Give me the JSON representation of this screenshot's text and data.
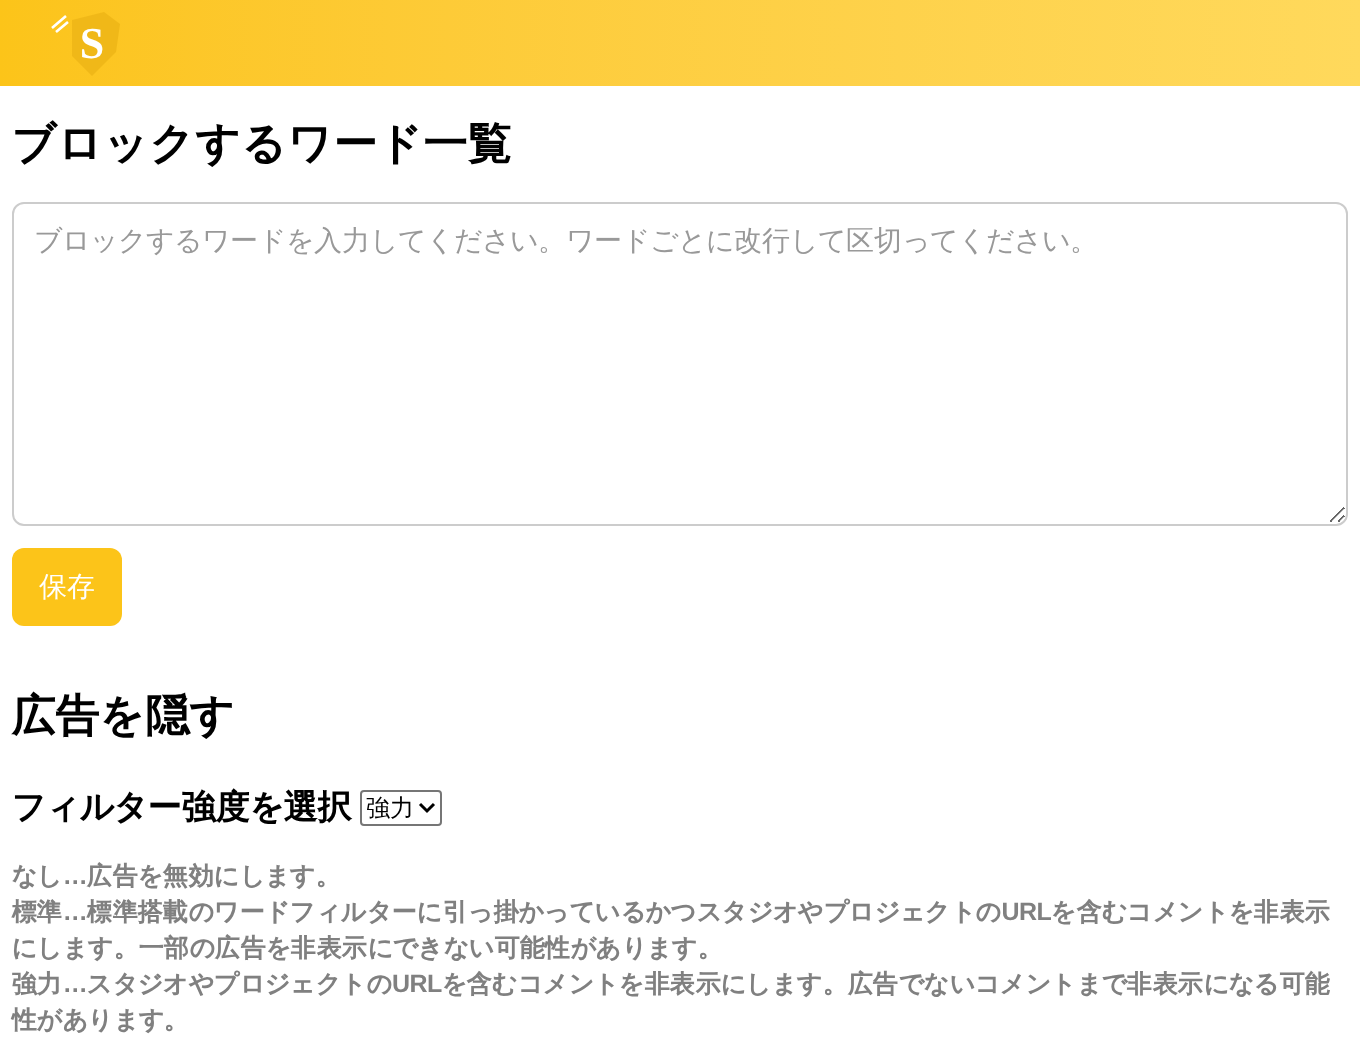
{
  "header": {
    "logo_letter": "S"
  },
  "block_words": {
    "title": "ブロックするワード一覧",
    "placeholder": "ブロックするワードを入力してください。ワードごとに改行して区切ってください。",
    "save_button": "保存"
  },
  "hide_ads": {
    "title": "広告を隠す",
    "filter_label": "フィルター強度を選択",
    "filter_value": "強力",
    "descriptions": [
      "なし…広告を無効にします。",
      "標準…標準搭載のワードフィルターに引っ掛かっているかつスタジオやプロジェクトのURLを含むコメントを非表示にします。一部の広告を非表示にできない可能性があります。",
      "強力…スタジオやプロジェクトのURLを含むコメントを非表示にします。広告でないコメントまで非表示になる可能性があります。"
    ]
  }
}
